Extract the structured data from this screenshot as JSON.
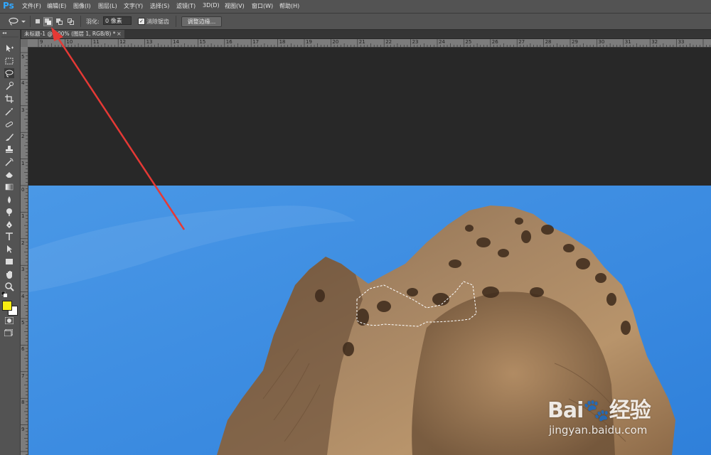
{
  "app": {
    "logo_text": "Ps"
  },
  "menubar": {
    "items": [
      "文件(F)",
      "编辑(E)",
      "图像(I)",
      "图层(L)",
      "文字(Y)",
      "选择(S)",
      "滤镜(T)",
      "3D(D)",
      "视图(V)",
      "窗口(W)",
      "帮助(H)"
    ]
  },
  "options": {
    "tool_icon": "lasso-icon",
    "selection_modes": [
      "new-selection",
      "add-to-selection",
      "subtract-from-selection",
      "intersect-selection"
    ],
    "active_mode_index": 1,
    "feather_label": "羽化:",
    "feather_value": "0 像素",
    "antialias_checked": true,
    "antialias_label": "消除锯齿",
    "refine_edge_label": "调整边缘..."
  },
  "document": {
    "tab_title": "未标题-1 @ 100% (图层 1, RGB/8) *",
    "tab_close": "×"
  },
  "rulers": {
    "top_numbers": [
      "9",
      "10",
      "11",
      "12",
      "13",
      "14",
      "15",
      "16",
      "17",
      "18",
      "19",
      "20",
      "21",
      "22",
      "23",
      "24",
      "25",
      "26",
      "27",
      "28",
      "29",
      "30",
      "31",
      "32",
      "33"
    ],
    "left_numbers": [
      "5",
      "4",
      "3",
      "2",
      "1",
      "0",
      "1",
      "2",
      "3",
      "4",
      "5",
      "6",
      "7",
      "8",
      "9"
    ]
  },
  "toolbar": {
    "tools": [
      "move-tool",
      "marquee-tool",
      "lasso-tool",
      "quick-select-tool",
      "crop-tool",
      "eyedropper-tool",
      "healing-tool",
      "brush-tool",
      "stamp-tool",
      "history-brush-tool",
      "eraser-tool",
      "gradient-tool",
      "blur-tool",
      "dodge-tool",
      "pen-tool",
      "type-tool",
      "path-select-tool",
      "shape-tool",
      "hand-tool",
      "zoom-tool"
    ],
    "foreground_color": "#f7ec12",
    "background_color": "#ffffff"
  },
  "colors": {
    "sky": "#3f8ee0",
    "rock": "#9c7a58",
    "arrow": "#e53935"
  },
  "watermark": {
    "logo": "Bai🐾经验",
    "url": "jingyan.baidu.com"
  }
}
